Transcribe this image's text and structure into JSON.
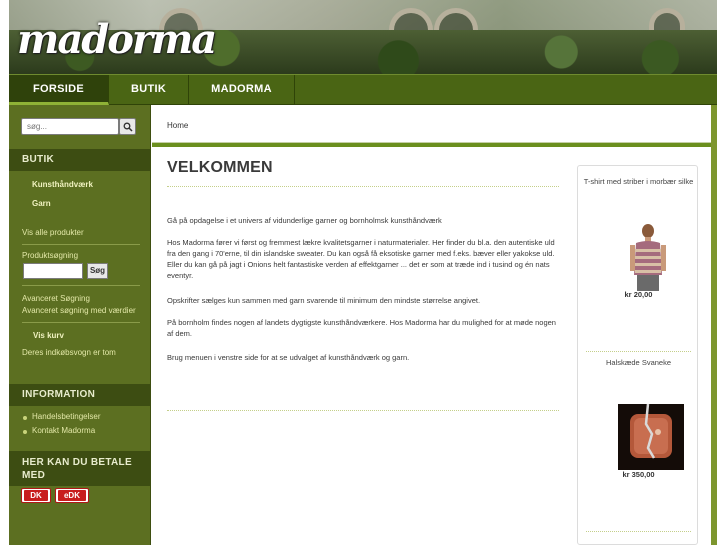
{
  "header": {
    "logo_text": "madorma"
  },
  "nav": {
    "items": [
      "FORSIDE",
      "BUTIK",
      "MADORMA"
    ],
    "active": "FORSIDE"
  },
  "search": {
    "placeholder": "søg..."
  },
  "sidebar": {
    "butik_heading": "BUTIK",
    "categories": [
      "Kunsthåndværk",
      "Garn"
    ],
    "show_all": "Vis alle produkter",
    "product_search_label": "Produktsøgning",
    "product_search_button": "Søg",
    "advanced_search": "Avanceret Søgning",
    "advanced_search_vars": "Avanceret søgning med værdier",
    "show_cart": "Vis kurv",
    "cart_empty": "Deres indkøbsvogn er tom",
    "info_heading": "INFORMATION",
    "info_links": [
      "Handelsbetingelser",
      "Kontakt Madorma"
    ],
    "pay_heading_line1": "HER KAN DU BETALE",
    "pay_heading_line2": "MED",
    "pay_cards": [
      "DK",
      "eDK"
    ]
  },
  "breadcrumb": "Home",
  "content": {
    "title": "VELKOMMEN",
    "p1": "Gå på opdagelse i et univers af vidunderlige garner og bornholmsk kunsthåndværk",
    "p2": "Hos Madorma fører vi først og fremmest lækre kvalitetsgarner i naturmaterialer. Her finder du bl.a. den autentiske uld fra den gang i 70'erne, til din islandske sweater. Du kan også få eksotiske garner med f.eks. bæver eller yakokse uld. Eller du kan gå på jagt i Onions helt fantastiske verden af effektgarner ... det er som at træde ind i tusind og én nats eventyr.",
    "p3": "Opskrifter sælges kun sammen med garn svarende til minimum den mindste størrelse angivet.",
    "p4": "På bornholm findes nogen af landets dygtigste kunsthåndværkere. Hos Madorma har du mulighed for at møde nogen af dem.",
    "p5": "Brug menuen i venstre side for at se udvalget af kunsthåndværk og garn."
  },
  "products": [
    {
      "name": "T-shirt med striber i morbær silke",
      "price": "kr 20,00"
    },
    {
      "name": "Halskæde Svaneke",
      "price": "kr 350,00"
    }
  ],
  "colors": {
    "nav_green": "#4a6514",
    "sidebar_green": "#5c6f21",
    "accent": "#6b8f1e"
  }
}
